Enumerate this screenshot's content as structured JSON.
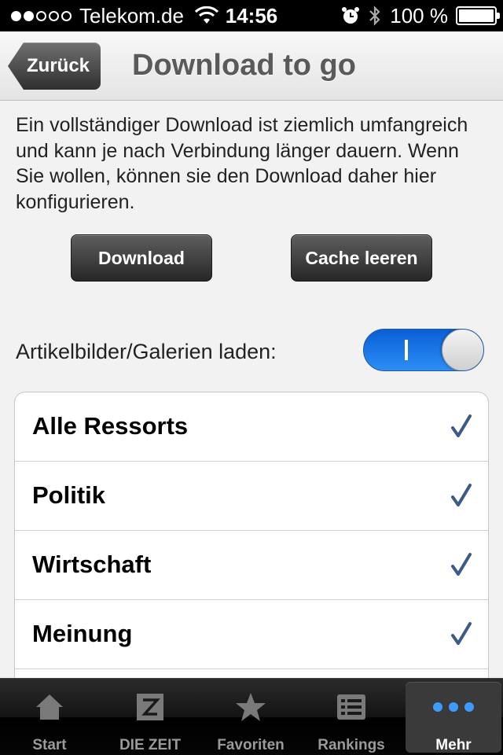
{
  "status_bar": {
    "carrier": "Telekom.de",
    "signal_bars_filled": 2,
    "signal_bars_total": 5,
    "time": "14:56",
    "battery_percent_label": "100 %",
    "battery_level": 1.0
  },
  "nav": {
    "back_label": "Zurück",
    "title": "Download to go"
  },
  "intro": {
    "text": "Ein vollständiger Download ist ziemlich umfangreich und kann je nach Verbindung länger dauern. Wenn Sie wollen, können sie den Download daher hier konfigurieren."
  },
  "actions": {
    "download_label": "Download",
    "cache_label": "Cache leeren"
  },
  "toggle": {
    "label": "Artikelbilder/Galerien laden:",
    "on": true,
    "accent_color": "#1a78e8"
  },
  "list": {
    "items": [
      {
        "label": "Alle Ressorts",
        "checked": true
      },
      {
        "label": "Politik",
        "checked": true
      },
      {
        "label": "Wirtschaft",
        "checked": true
      },
      {
        "label": "Meinung",
        "checked": true
      }
    ],
    "check_color": "#3a5a8c"
  },
  "tab_bar": {
    "tabs": [
      {
        "label": "Start",
        "icon": "home-icon",
        "active": false
      },
      {
        "label": "DIE ZEIT",
        "icon": "zeit-logo-icon",
        "active": false
      },
      {
        "label": "Favoriten",
        "icon": "star-icon",
        "active": false
      },
      {
        "label": "Rankings",
        "icon": "list-icon",
        "active": false
      },
      {
        "label": "Mehr",
        "icon": "more-dots-icon",
        "active": true
      }
    ]
  }
}
